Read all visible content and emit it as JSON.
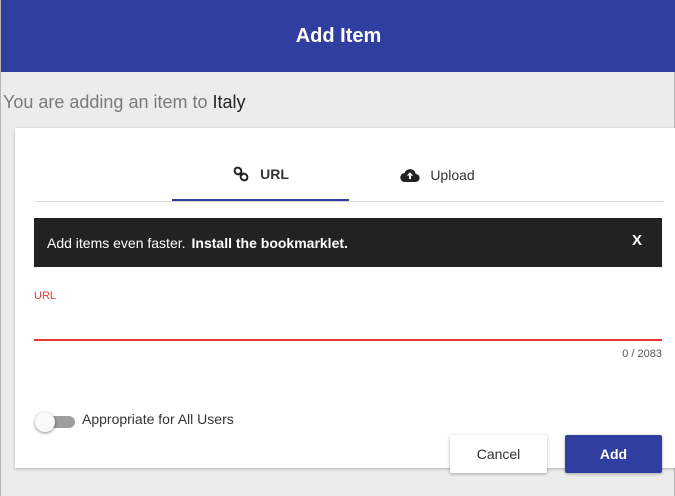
{
  "dialog": {
    "title": "Add Item",
    "accent_color": "#303f9f"
  },
  "subtitle": {
    "prefix": "You are adding an item to",
    "place": "Italy"
  },
  "tabs": [
    {
      "label": "URL",
      "icon": "link-icon",
      "selected": true
    },
    {
      "label": "Upload",
      "icon": "cloud-upload-icon",
      "selected": false
    }
  ],
  "banner": {
    "lead_text": "Add items even faster.",
    "link_text": "Install the bookmarklet.",
    "close_label": "X"
  },
  "url_field": {
    "label": "URL",
    "value": "",
    "counter": "0 / 2083",
    "error_color": "#e53935"
  },
  "appropriate_toggle": {
    "label": "Appropriate for All Users",
    "checked": false
  },
  "actions": {
    "cancel_label": "Cancel",
    "add_label": "Add"
  }
}
